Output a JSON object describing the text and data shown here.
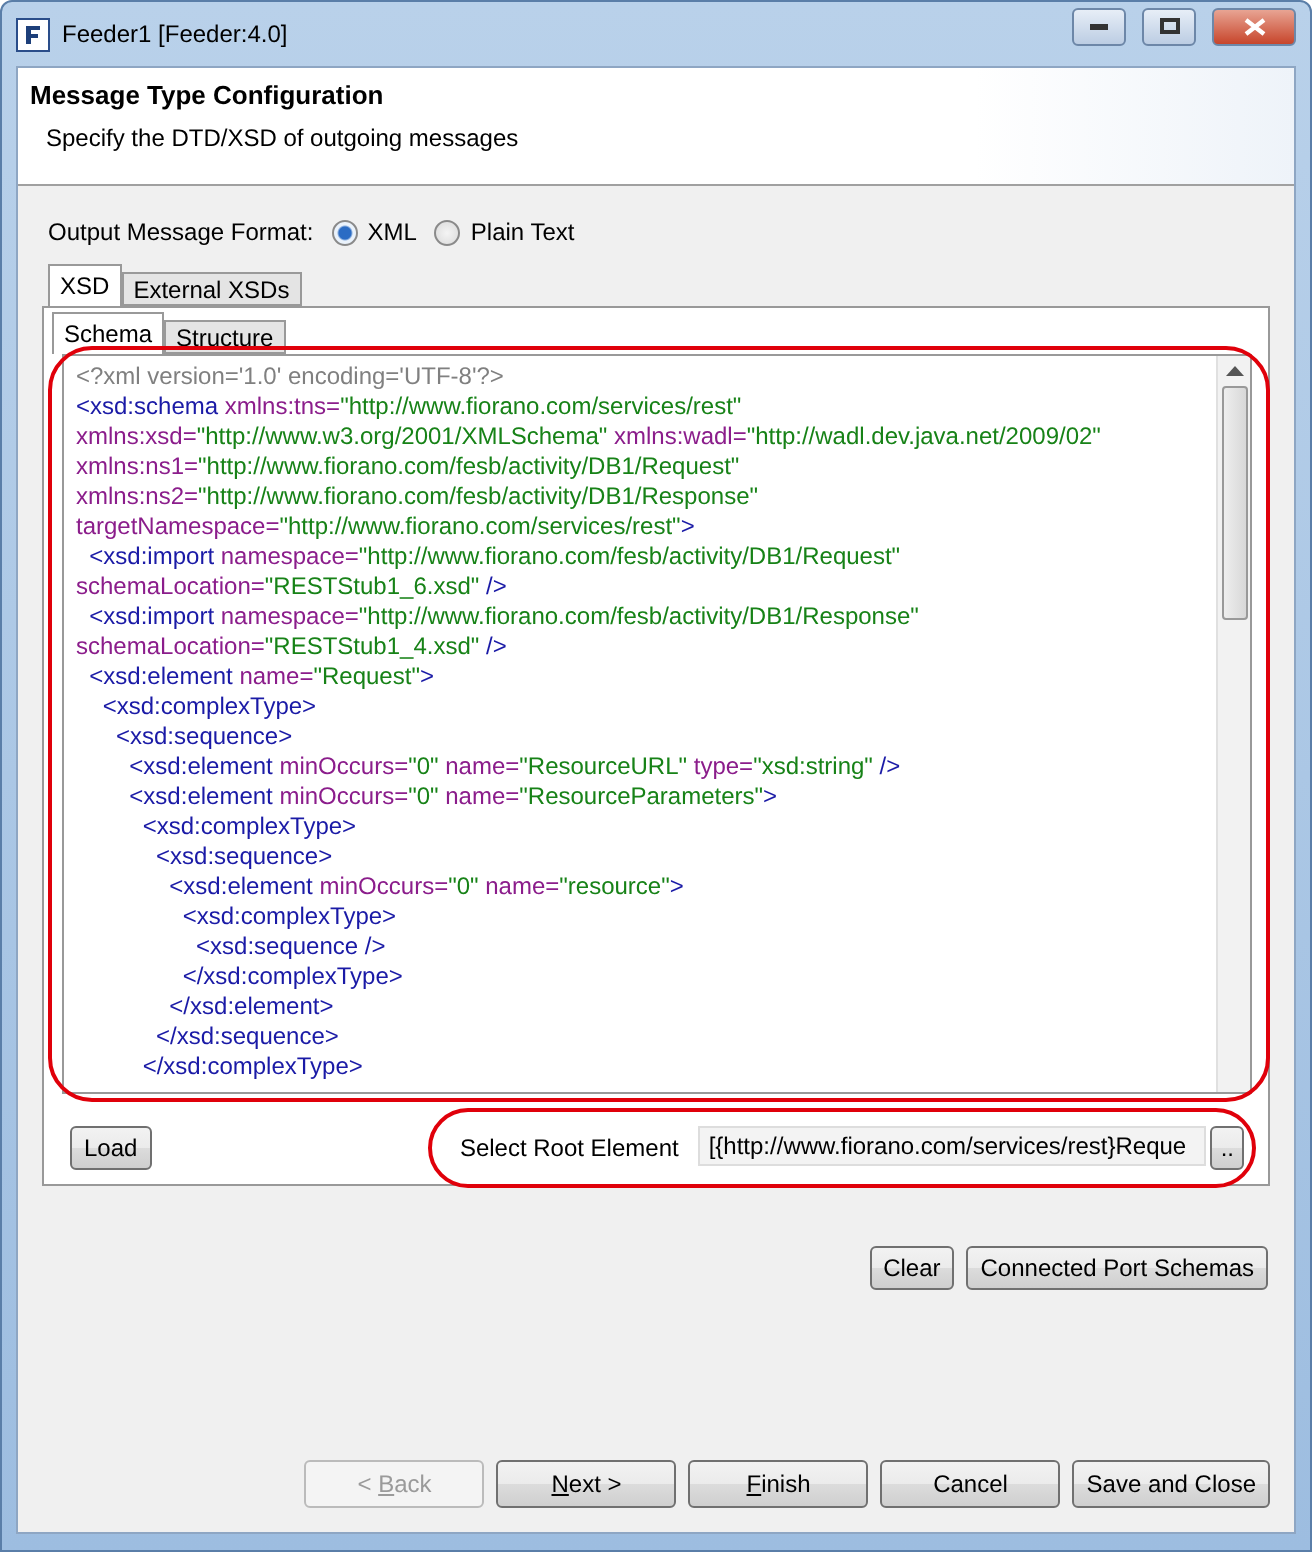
{
  "window": {
    "title": "Feeder1 [Feeder:4.0]",
    "controls": [
      {
        "kind": "minimize"
      },
      {
        "kind": "maximize"
      },
      {
        "kind": "close"
      }
    ]
  },
  "header": {
    "title": "Message Type Configuration",
    "subtitle": "Specify the DTD/XSD of outgoing messages"
  },
  "format": {
    "label": "Output Message Format:",
    "options": [
      {
        "label": "XML",
        "selected": true
      },
      {
        "label": "Plain Text",
        "selected": false
      }
    ]
  },
  "tabs": [
    {
      "label": "XSD",
      "selected": true
    },
    {
      "label": "External XSDs",
      "selected": false
    }
  ],
  "subtabs": [
    {
      "label": "Schema",
      "selected": true
    },
    {
      "label": "Structure",
      "selected": false
    }
  ],
  "editor": {
    "highlighted": true,
    "lines": [
      [
        {
          "kind": "prolog",
          "text": "<?xml version='1.0' encoding='UTF-8'?>"
        }
      ],
      [
        {
          "kind": "tag",
          "text": "<xsd:schema"
        },
        {
          "kind": "attr",
          "text": " xmlns:tns="
        },
        {
          "kind": "val",
          "text": "\"http://www.fiorano.com/services/rest\""
        }
      ],
      [
        {
          "kind": "attr",
          "text": "xmlns:xsd="
        },
        {
          "kind": "val",
          "text": "\"http://www.w3.org/2001/XMLSchema\""
        },
        {
          "kind": "attr",
          "text": " xmlns:wadl="
        },
        {
          "kind": "val",
          "text": "\"http://wadl.dev.java.net/2009/02\""
        }
      ],
      [
        {
          "kind": "attr",
          "text": "xmlns:ns1="
        },
        {
          "kind": "val",
          "text": "\"http://www.fiorano.com/fesb/activity/DB1/Request\""
        }
      ],
      [
        {
          "kind": "attr",
          "text": "xmlns:ns2="
        },
        {
          "kind": "val",
          "text": "\"http://www.fiorano.com/fesb/activity/DB1/Response\""
        }
      ],
      [
        {
          "kind": "attr",
          "text": "targetNamespace="
        },
        {
          "kind": "val",
          "text": "\"http://www.fiorano.com/services/rest\""
        },
        {
          "kind": "tag",
          "text": ">"
        }
      ],
      [
        {
          "kind": "tag",
          "text": "  <xsd:import"
        },
        {
          "kind": "attr",
          "text": " namespace="
        },
        {
          "kind": "val",
          "text": "\"http://www.fiorano.com/fesb/activity/DB1/Request\""
        }
      ],
      [
        {
          "kind": "attr",
          "text": "schemaLocation="
        },
        {
          "kind": "val",
          "text": "\"RESTStub1_6.xsd\""
        },
        {
          "kind": "tag",
          "text": " />"
        }
      ],
      [
        {
          "kind": "tag",
          "text": "  <xsd:import"
        },
        {
          "kind": "attr",
          "text": " namespace="
        },
        {
          "kind": "val",
          "text": "\"http://www.fiorano.com/fesb/activity/DB1/Response\""
        }
      ],
      [
        {
          "kind": "attr",
          "text": "schemaLocation="
        },
        {
          "kind": "val",
          "text": "\"RESTStub1_4.xsd\""
        },
        {
          "kind": "tag",
          "text": " />"
        }
      ],
      [
        {
          "kind": "tag",
          "text": "  <xsd:element"
        },
        {
          "kind": "attr",
          "text": " name="
        },
        {
          "kind": "val",
          "text": "\"Request\""
        },
        {
          "kind": "tag",
          "text": ">"
        }
      ],
      [
        {
          "kind": "tag",
          "text": "    <xsd:complexType>"
        }
      ],
      [
        {
          "kind": "tag",
          "text": "      <xsd:sequence>"
        }
      ],
      [
        {
          "kind": "tag",
          "text": "        <xsd:element"
        },
        {
          "kind": "attr",
          "text": " minOccurs="
        },
        {
          "kind": "val",
          "text": "\"0\""
        },
        {
          "kind": "attr",
          "text": " name="
        },
        {
          "kind": "val",
          "text": "\"ResourceURL\""
        },
        {
          "kind": "attr",
          "text": " type="
        },
        {
          "kind": "val",
          "text": "\"xsd:string\""
        },
        {
          "kind": "tag",
          "text": " />"
        }
      ],
      [
        {
          "kind": "tag",
          "text": "        <xsd:element"
        },
        {
          "kind": "attr",
          "text": " minOccurs="
        },
        {
          "kind": "val",
          "text": "\"0\""
        },
        {
          "kind": "attr",
          "text": " name="
        },
        {
          "kind": "val",
          "text": "\"ResourceParameters\""
        },
        {
          "kind": "tag",
          "text": ">"
        }
      ],
      [
        {
          "kind": "tag",
          "text": "          <xsd:complexType>"
        }
      ],
      [
        {
          "kind": "tag",
          "text": "            <xsd:sequence>"
        }
      ],
      [
        {
          "kind": "tag",
          "text": "              <xsd:element"
        },
        {
          "kind": "attr",
          "text": " minOccurs="
        },
        {
          "kind": "val",
          "text": "\"0\""
        },
        {
          "kind": "attr",
          "text": " name="
        },
        {
          "kind": "val",
          "text": "\"resource\""
        },
        {
          "kind": "tag",
          "text": ">"
        }
      ],
      [
        {
          "kind": "tag",
          "text": "                <xsd:complexType>"
        }
      ],
      [
        {
          "kind": "tag",
          "text": "                  <xsd:sequence />"
        }
      ],
      [
        {
          "kind": "tag",
          "text": "                </xsd:complexType>"
        }
      ],
      [
        {
          "kind": "tag",
          "text": "              </xsd:element>"
        }
      ],
      [
        {
          "kind": "tag",
          "text": "            </xsd:sequence>"
        }
      ],
      [
        {
          "kind": "tag",
          "text": "          </xsd:complexType>"
        }
      ]
    ]
  },
  "load_button": "Load",
  "root_element": {
    "highlighted": true,
    "label": "Select Root Element",
    "value": "[{http://www.fiorano.com/services/rest}Reque",
    "browse": ".."
  },
  "schema_buttons": [
    "Clear",
    "Connected Port Schemas"
  ],
  "nav_buttons": [
    {
      "pre": "< ",
      "key": "B",
      "post": "ack",
      "disabled": true
    },
    {
      "key": "N",
      "post": "ext >",
      "disabled": false
    },
    {
      "key": "F",
      "post": "inish",
      "disabled": false
    },
    {
      "post": "Cancel",
      "disabled": false
    },
    {
      "post": "Save and Close",
      "disabled": false
    }
  ]
}
